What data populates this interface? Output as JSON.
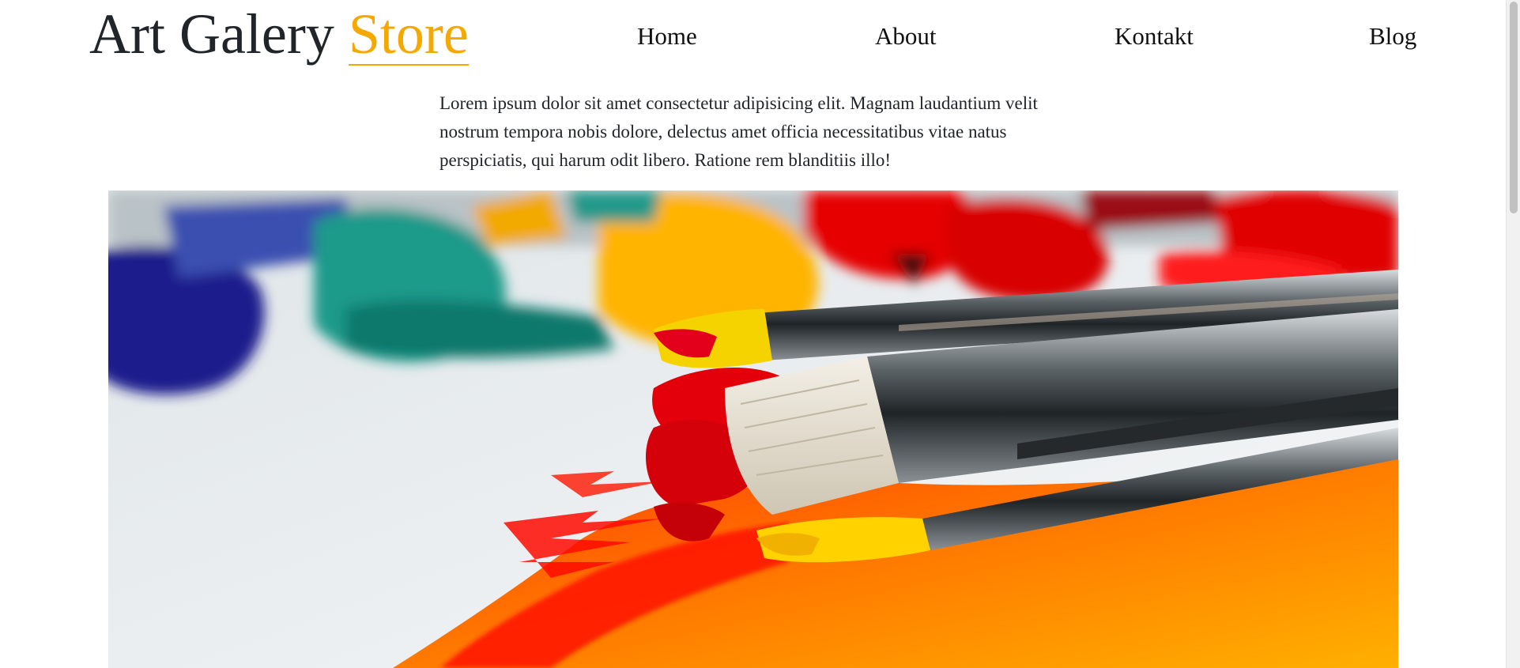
{
  "header": {
    "logo_main": "Art Galery",
    "logo_accent": "Store",
    "accent_color": "#f5a800"
  },
  "nav": {
    "items": [
      {
        "label": "Home"
      },
      {
        "label": "About"
      },
      {
        "label": "Kontakt"
      },
      {
        "label": "Blog"
      }
    ]
  },
  "intro": {
    "text": "Lorem ipsum dolor sit amet consectetur adipisicing elit. Magnam laudantium velit nostrum tempora nobis dolore, delectus amet officia necessitatibus vitae natus perspiciatis, qui harum odit libero. Ratione rem blanditiis illo!"
  },
  "hero": {
    "subject": "paint brushes with red, yellow and orange paint over paint tubes",
    "colors": {
      "blue": "#1a1a8c",
      "teal": "#1a9a8a",
      "yellow": "#ffb400",
      "red": "#e60000",
      "orange": "#ff8a00"
    }
  }
}
